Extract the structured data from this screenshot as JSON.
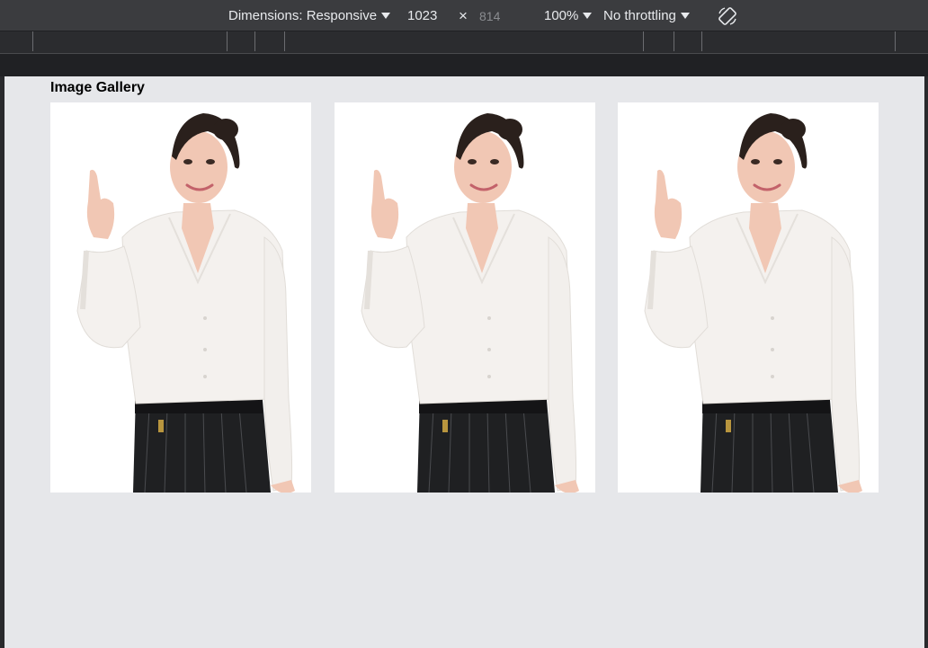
{
  "toolbar": {
    "dimensions_label": "Dimensions: Responsive",
    "width": "1023",
    "times": "×",
    "height": "814",
    "zoom": "100%",
    "throttle": "No throttling",
    "rotate_icon": "rotate-icon"
  },
  "page": {
    "title": "Image Gallery",
    "images": [
      {
        "subject": "woman-pointing-up"
      },
      {
        "subject": "woman-pointing-up"
      },
      {
        "subject": "woman-pointing-up"
      }
    ]
  },
  "colors": {
    "toolbar_bg": "#3b3c3f",
    "viewport_bg": "#e6e7ea",
    "shirt": "#f4f1ee",
    "pants": "#1f2022",
    "hair": "#2a201c",
    "skin": "#f1c7b4"
  }
}
